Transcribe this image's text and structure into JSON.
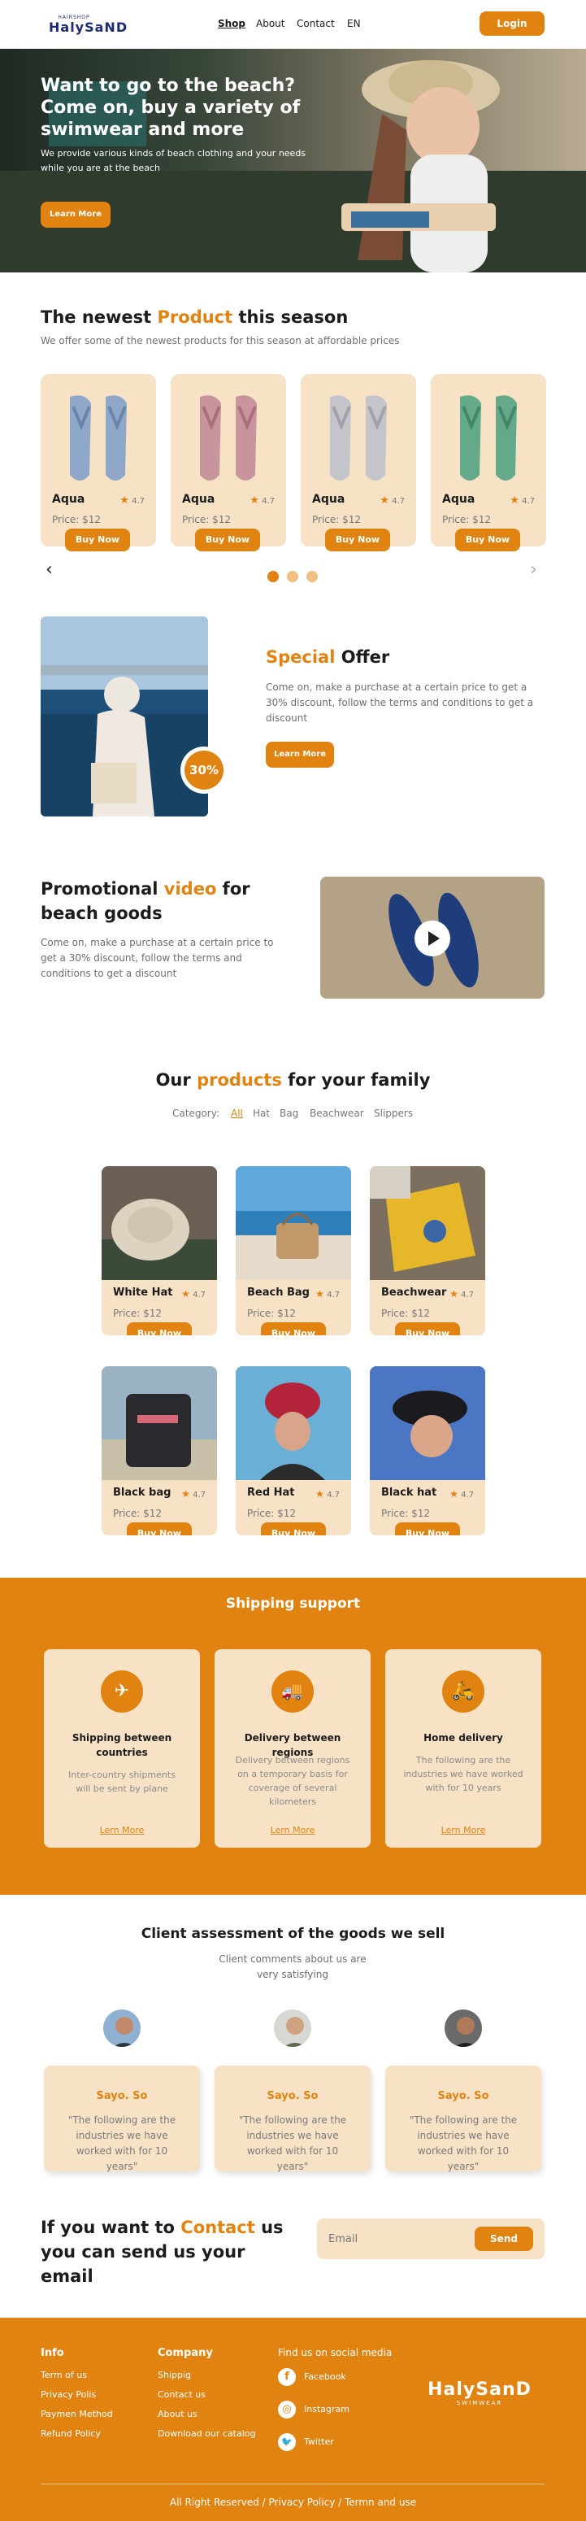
{
  "header": {
    "logo_small": "HAIRSHOP",
    "logo_big": "HalySaND",
    "nav": [
      "Shop",
      "About",
      "Contact",
      "EN"
    ],
    "login": "Login"
  },
  "hero": {
    "title": "Want to go to the beach? Come on, buy a variety of swimwear and more",
    "subtitle": "We provide various kinds of beach clothing and your needs while you are at the beach",
    "button": "Learn More"
  },
  "newest": {
    "title_a": "The newest ",
    "title_b": "Product",
    "title_c": " this season",
    "subtitle": "We offer some of the newest products for this season at affordable prices",
    "products": [
      {
        "name": "Aqua",
        "rating": "4.7",
        "price": "Price: $12",
        "button": "Buy Now",
        "color": "#8fa7c8"
      },
      {
        "name": "Aqua",
        "rating": "4.7",
        "price": "Price: $12",
        "button": "Buy Now",
        "color": "#c9959c"
      },
      {
        "name": "Aqua",
        "rating": "4.7",
        "price": "Price: $12",
        "button": "Buy Now",
        "color": "#c4c5cb"
      },
      {
        "name": "Aqua",
        "rating": "4.7",
        "price": "Price: $12",
        "button": "Buy Now",
        "color": "#63a98a"
      }
    ],
    "prev": "‹",
    "next": "›"
  },
  "offer": {
    "title_a": "Special",
    "title_b": " Offer",
    "text": "Come on, make a purchase at a certain price to get a 30% discount, follow the terms and conditions to get a discount",
    "badge": "30%",
    "button": "Learn More"
  },
  "video": {
    "title_a": "Promotional ",
    "title_b": "video",
    "title_c": " for beach goods",
    "text": "Come on, make a purchase at a certain price to get a 30% discount, follow the terms and conditions to get a discount"
  },
  "family": {
    "title_a": "Our ",
    "title_b": "products",
    "title_c": " for your family",
    "category_label": "Category:",
    "categories": [
      "All",
      "Hat",
      "Bag",
      "Beachwear",
      "Slippers"
    ],
    "products": [
      {
        "name": "White Hat",
        "rating": "4.7",
        "price": "Price: $12",
        "button": "Buy Now"
      },
      {
        "name": "Beach Bag",
        "rating": "4.7",
        "price": "Price: $12",
        "button": "Buy Now"
      },
      {
        "name": "Beachwear",
        "rating": "4.7",
        "price": "Price: $12",
        "button": "Buy Now"
      },
      {
        "name": "Black bag",
        "rating": "4.7",
        "price": "Price: $12",
        "button": "Buy Now"
      },
      {
        "name": "Red Hat",
        "rating": "4.7",
        "price": "Price: $12",
        "button": "Buy Now"
      },
      {
        "name": "Black hat",
        "rating": "4.7",
        "price": "Price: $12",
        "button": "Buy Now"
      }
    ]
  },
  "shipping": {
    "title": "Shipping support",
    "cards": [
      {
        "title": "Shipping between countries",
        "text": "Inter-country shipments will be sent by plane",
        "link": "Lern More",
        "icon": "plane-icon",
        "glyph": "✈"
      },
      {
        "title": "Delivery between regions",
        "text": "Delivery between regions on a temporary basis for coverage of several kilometers",
        "link": "Lern More",
        "icon": "truck-icon",
        "glyph": "🚚"
      },
      {
        "title": "Home delivery",
        "text": "The following are the industries we have worked with for 10 years",
        "link": "Lern More",
        "icon": "motorbike-icon",
        "glyph": "🛵"
      }
    ]
  },
  "clients": {
    "title": "Client assessment of the goods we sell",
    "subtitle": "Client comments about us are very satisfying",
    "items": [
      {
        "name": "Sayo. So",
        "quote": "\"The following are the industries we have worked with for 10 years\""
      },
      {
        "name": "Sayo. So",
        "quote": "\"The following are the industries we have worked with for 10 years\""
      },
      {
        "name": "Sayo. So",
        "quote": "\"The following are the industries we have worked with for 10 years\""
      }
    ]
  },
  "contact": {
    "title_a": "If you want to ",
    "title_b": "Contact",
    "title_c": " us you can send us your email",
    "placeholder": "Email",
    "button": "Send"
  },
  "footer": {
    "info_title": "Info",
    "info": [
      "Term of us",
      "Privacy Polis",
      "Paymen Method",
      "Refund Policy"
    ],
    "company_title": "Company",
    "company": [
      "Shippig",
      "Contact us",
      "About us",
      "Download our catalog"
    ],
    "social_title": "Find us on social media",
    "social": [
      {
        "label": "Facebook",
        "icon": "facebook-icon",
        "glyph": "f"
      },
      {
        "label": "Instagram",
        "icon": "instagram-icon",
        "glyph": "◎"
      },
      {
        "label": "Twitter",
        "icon": "twitter-icon",
        "glyph": "🐦"
      }
    ],
    "logo_big": "HalySanD",
    "logo_small": "SWIMWEAR",
    "copyright": "All Right Reserved / Privacy Policy / Termn and use"
  }
}
